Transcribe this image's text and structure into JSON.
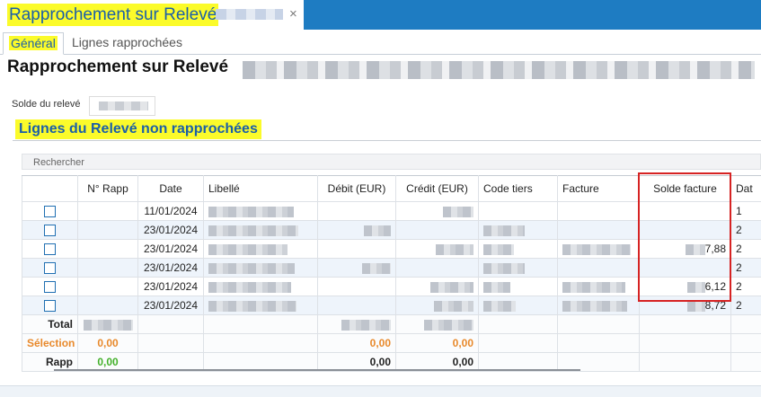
{
  "window": {
    "doc_tab_title": "Rapprochement sur Relevé",
    "close_glyph": "×"
  },
  "tabs": [
    {
      "label": "Général"
    },
    {
      "label": "Lignes rapprochées"
    }
  ],
  "page": {
    "title": "Rapprochement sur Relevé"
  },
  "solde": {
    "label": "Solde du relevé"
  },
  "section": {
    "title": "Lignes du Relevé non rapprochées"
  },
  "search": {
    "placeholder": "Rechercher"
  },
  "grid": {
    "columns": [
      "",
      "N° Rapp",
      "Date",
      "Libellé",
      "Débit (EUR)",
      "Crédit (EUR)",
      "Code tiers",
      "Facture",
      "Solde facture",
      "Dat"
    ],
    "rows": [
      {
        "date": "11/01/2024",
        "solde": "",
        "tail": "1"
      },
      {
        "date": "23/01/2024",
        "solde": "",
        "tail": "2"
      },
      {
        "date": "23/01/2024",
        "solde": "7,88",
        "tail": "2"
      },
      {
        "date": "23/01/2024",
        "solde": "",
        "tail": "2"
      },
      {
        "date": "23/01/2024",
        "solde": "6,12",
        "tail": "2"
      },
      {
        "date": "23/01/2024",
        "solde": "8,72",
        "tail": "2"
      }
    ],
    "summary": {
      "total_label": "Total",
      "selection_label": "Sélection",
      "selection_rapp": "0,00",
      "selection_debit": "0,00",
      "selection_credit": "0,00",
      "rapp_label": "Rapp",
      "rapp_rapp": "0,00",
      "rapp_debit": "0,00",
      "rapp_credit": "0,00"
    }
  },
  "colors": {
    "titlebar": "#1e7cc2",
    "highlight_yellow": "#fbfb2a",
    "title_blue": "#1b5fa8",
    "checkbox_blue": "#1f6fb2",
    "selection_orange": "#e8892b",
    "rapp_green": "#43b02a",
    "annotation_red": "#d62323"
  },
  "icons": {
    "close": "close-icon",
    "checkbox": "checkbox-icon"
  }
}
